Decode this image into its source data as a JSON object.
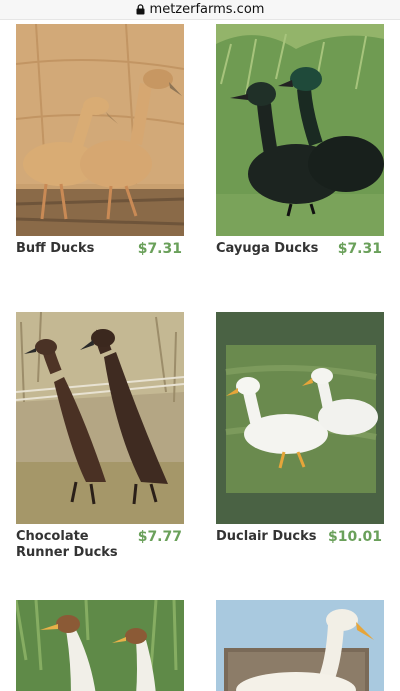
{
  "browser": {
    "url": "metzerfarms.com"
  },
  "products": [
    {
      "name": "Buff Ducks",
      "price": "$7.31"
    },
    {
      "name": "Cayuga Ducks",
      "price": "$7.31"
    },
    {
      "name": "Chocolate Runner Ducks",
      "price": "$7.77"
    },
    {
      "name": "Duclair Ducks",
      "price": "$10.01"
    },
    {
      "name": "",
      "price": ""
    },
    {
      "name": "",
      "price": ""
    }
  ],
  "colors": {
    "price": "#6aa05a",
    "duclair_frame": "#4a6244"
  }
}
